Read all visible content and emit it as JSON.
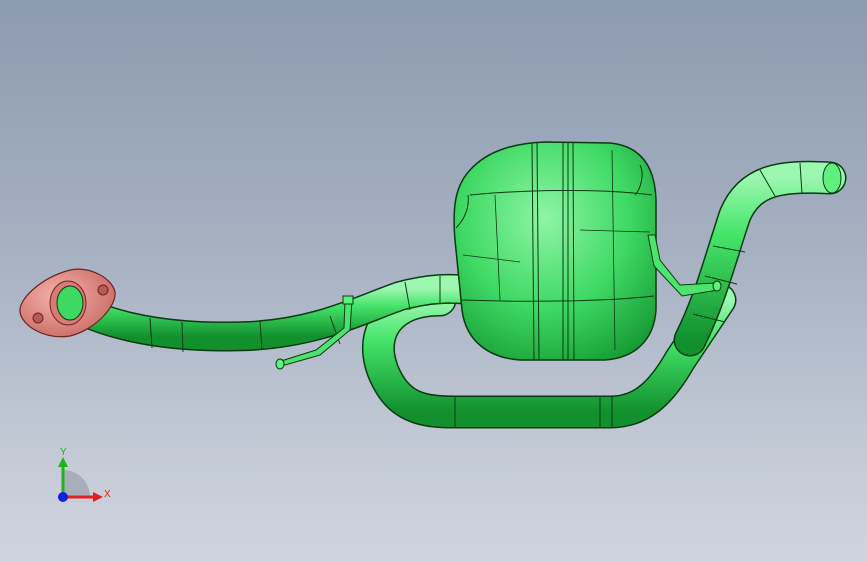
{
  "viewport": {
    "model_color": "#36e060",
    "edge_color": "#0a3a12",
    "flange_color": "#e88a86"
  },
  "triad": {
    "x_label": "X",
    "y_label": "Y",
    "x_color": "#e02020",
    "y_color": "#20b020",
    "z_color": "#1020e0"
  }
}
